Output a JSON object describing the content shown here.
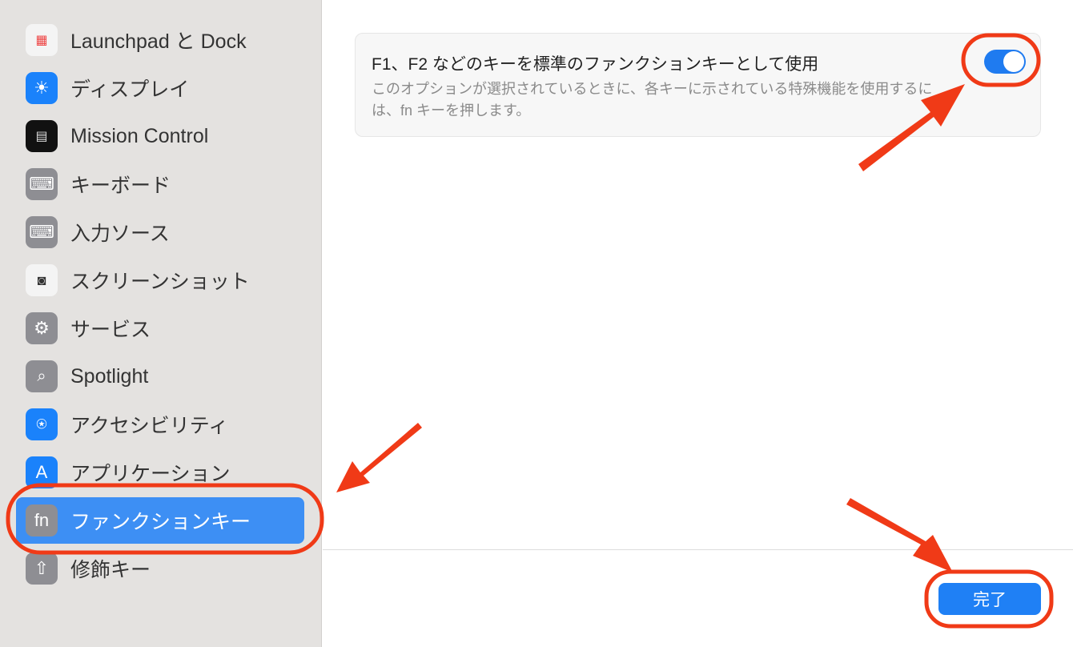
{
  "sidebar": {
    "items": [
      {
        "label": "Launchpad と Dock",
        "icon": "launchpad-icon"
      },
      {
        "label": "ディスプレイ",
        "icon": "display-icon"
      },
      {
        "label": "Mission Control",
        "icon": "mission-control-icon"
      },
      {
        "label": "キーボード",
        "icon": "keyboard-icon"
      },
      {
        "label": "入力ソース",
        "icon": "input-source-icon"
      },
      {
        "label": "スクリーンショット",
        "icon": "screenshot-icon"
      },
      {
        "label": "サービス",
        "icon": "services-icon"
      },
      {
        "label": "Spotlight",
        "icon": "spotlight-icon"
      },
      {
        "label": "アクセシビリティ",
        "icon": "accessibility-icon"
      },
      {
        "label": "アプリケーション",
        "icon": "app-store-icon"
      },
      {
        "label": "ファンクションキー",
        "icon": "fn-icon",
        "selected": true
      },
      {
        "label": "修飾キー",
        "icon": "modifier-icon"
      }
    ]
  },
  "main": {
    "option": {
      "title": "F1、F2 などのキーを標準のファンクションキーとして使用",
      "description": "このオプションが選択されているときに、各キーに示されている特殊機能を使用するには、fn キーを押します。",
      "enabled": true
    },
    "done_label": "完了"
  },
  "colors": {
    "accent": "#1f80f5",
    "annotation": "#f03a17"
  }
}
